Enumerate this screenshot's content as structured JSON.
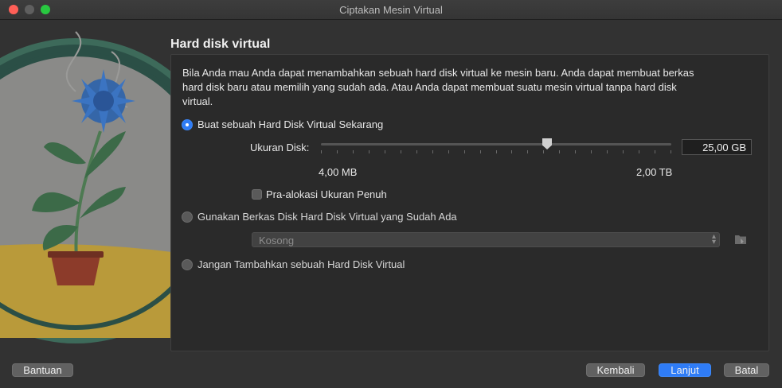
{
  "window": {
    "title": "Ciptakan Mesin Virtual"
  },
  "page": {
    "heading": "Hard disk virtual",
    "description": "Bila Anda mau Anda dapat menambahkan sebuah hard disk virtual ke mesin baru. Anda dapat membuat berkas hard disk baru atau memilih yang sudah ada. Atau Anda dapat membuat suatu mesin virtual tanpa hard disk virtual."
  },
  "options": {
    "create_new": {
      "label": "Buat sebuah Hard Disk Virtual Sekarang",
      "selected": true
    },
    "use_existing": {
      "label": "Gunakan Berkas Disk Hard Disk Virtual yang Sudah Ada",
      "selected": false
    },
    "none": {
      "label": "Jangan Tambahkan sebuah Hard Disk Virtual",
      "selected": false
    }
  },
  "disk_size": {
    "label": "Ukuran Disk:",
    "value": "25,00 GB",
    "min_label": "4,00 MB",
    "max_label": "2,00 TB",
    "slider_fraction": 0.65
  },
  "preallocate": {
    "label": "Pra-alokasi Ukuran Penuh",
    "checked": false
  },
  "existing_file_select": {
    "value": "Kosong"
  },
  "buttons": {
    "help": "Bantuan",
    "back": "Kembali",
    "next": "Lanjut",
    "cancel": "Batal"
  },
  "icons": {
    "folder": "folder-icon",
    "select_chevron": "chevron-updown-icon"
  },
  "colors": {
    "accent": "#2f7cf6"
  }
}
